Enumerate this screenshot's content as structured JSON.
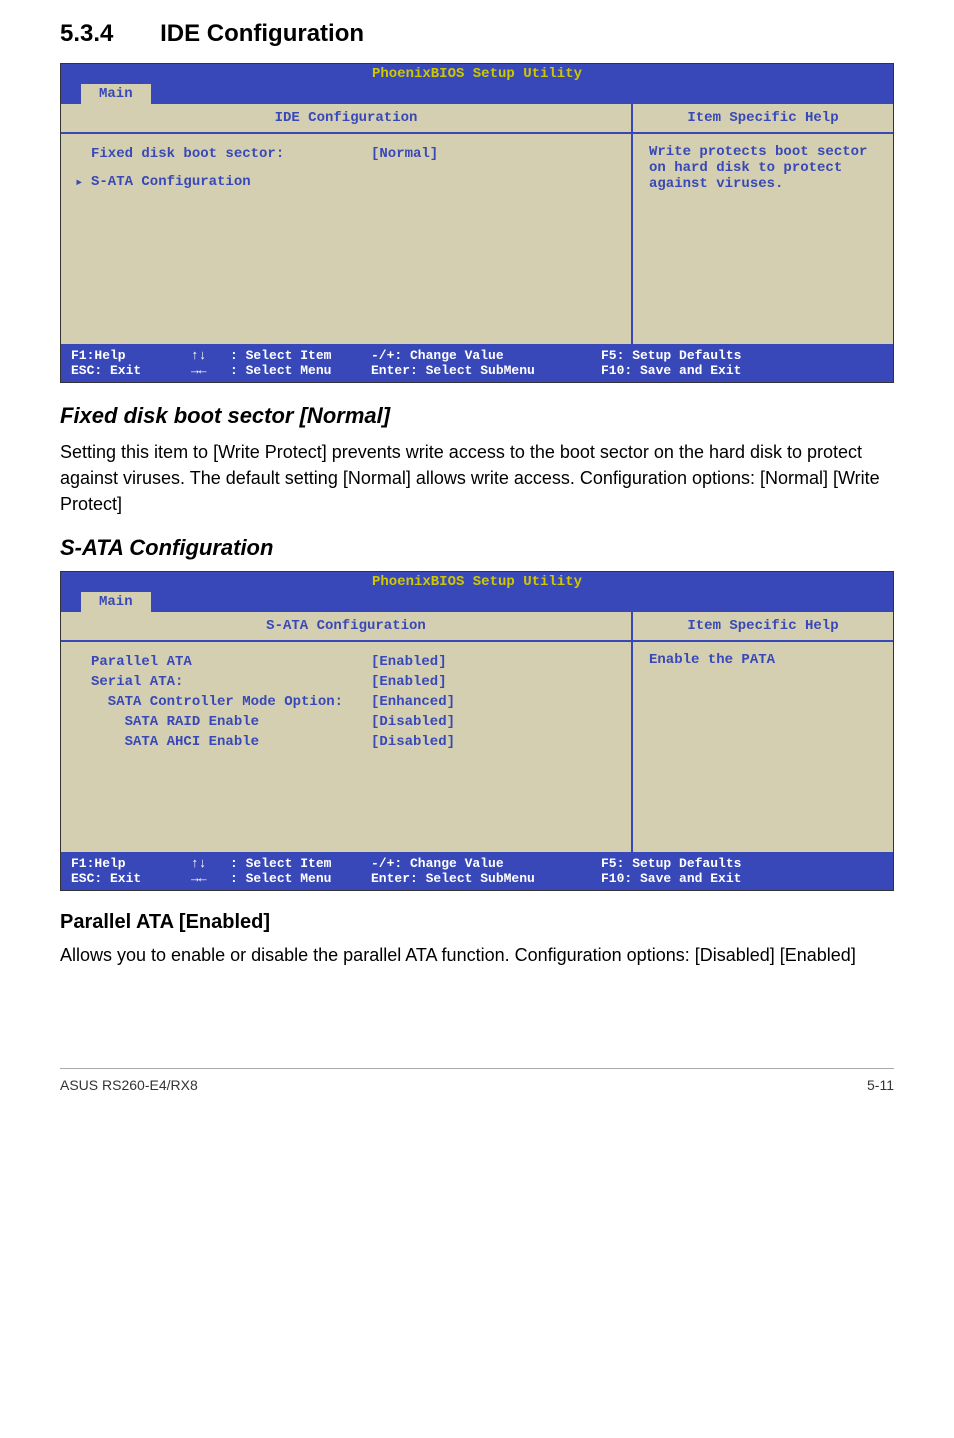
{
  "section": {
    "num": "5.3.4",
    "title": "IDE Configuration"
  },
  "bios1": {
    "title": "PhoenixBIOS Setup Utility",
    "tab": "Main",
    "panel_header": "IDE Configuration",
    "fixed_disk_label": "Fixed disk boot sector:",
    "fixed_disk_value": "[Normal]",
    "sata_config_label": "S-ATA Configuration",
    "help_header": "Item Specific Help",
    "help_text": "Write protects boot sector on hard disk to protect against viruses.",
    "footer": {
      "f1": "F1:Help",
      "esc": "ESC: Exit",
      "arrows_v": "↑↓",
      "select_item": ": Select Item",
      "arrows_h": "→←",
      "select_menu": ": Select Menu",
      "change_value": "-/+: Change Value",
      "enter_submenu": "Enter: Select SubMenu",
      "f5": "F5: Setup Defaults",
      "f10": "F10: Save and Exit"
    }
  },
  "heading1": "Fixed disk boot sector [Normal]",
  "para1": "Setting this item to [Write Protect] prevents write access to the boot sector on the hard disk to protect against viruses. The default setting [Normal] allows write access. Configuration options: [Normal] [Write Protect]",
  "heading2": "S-ATA Configuration",
  "bios2": {
    "title": "PhoenixBIOS Setup Utility",
    "tab": "Main",
    "panel_header": "S-ATA Configuration",
    "rows": [
      {
        "label": "Parallel ATA",
        "value": "[Enabled]"
      },
      {
        "label": "Serial ATA:",
        "value": "[Enabled]"
      },
      {
        "label": "  SATA Controller Mode Option:",
        "value": "[Enhanced]"
      },
      {
        "label": "    SATA RAID Enable",
        "value": "[Disabled]"
      },
      {
        "label": "    SATA AHCI Enable",
        "value": "[Disabled]"
      }
    ],
    "help_header": "Item Specific Help",
    "help_text": "Enable the PATA",
    "footer": {
      "f1": "F1:Help",
      "esc": "ESC: Exit",
      "arrows_v": "↑↓",
      "select_item": ": Select Item",
      "arrows_h": "→←",
      "select_menu": ": Select Menu",
      "change_value": "-/+: Change Value",
      "enter_submenu": "Enter: Select SubMenu",
      "f5": "F5: Setup Defaults",
      "f10": "F10: Save and Exit"
    }
  },
  "heading3": "Parallel ATA [Enabled]",
  "para2": "Allows you to enable or disable the parallel ATA function. Configuration options: [Disabled] [Enabled]",
  "footer": {
    "left": "ASUS RS260-E4/RX8",
    "right": "5-11"
  }
}
